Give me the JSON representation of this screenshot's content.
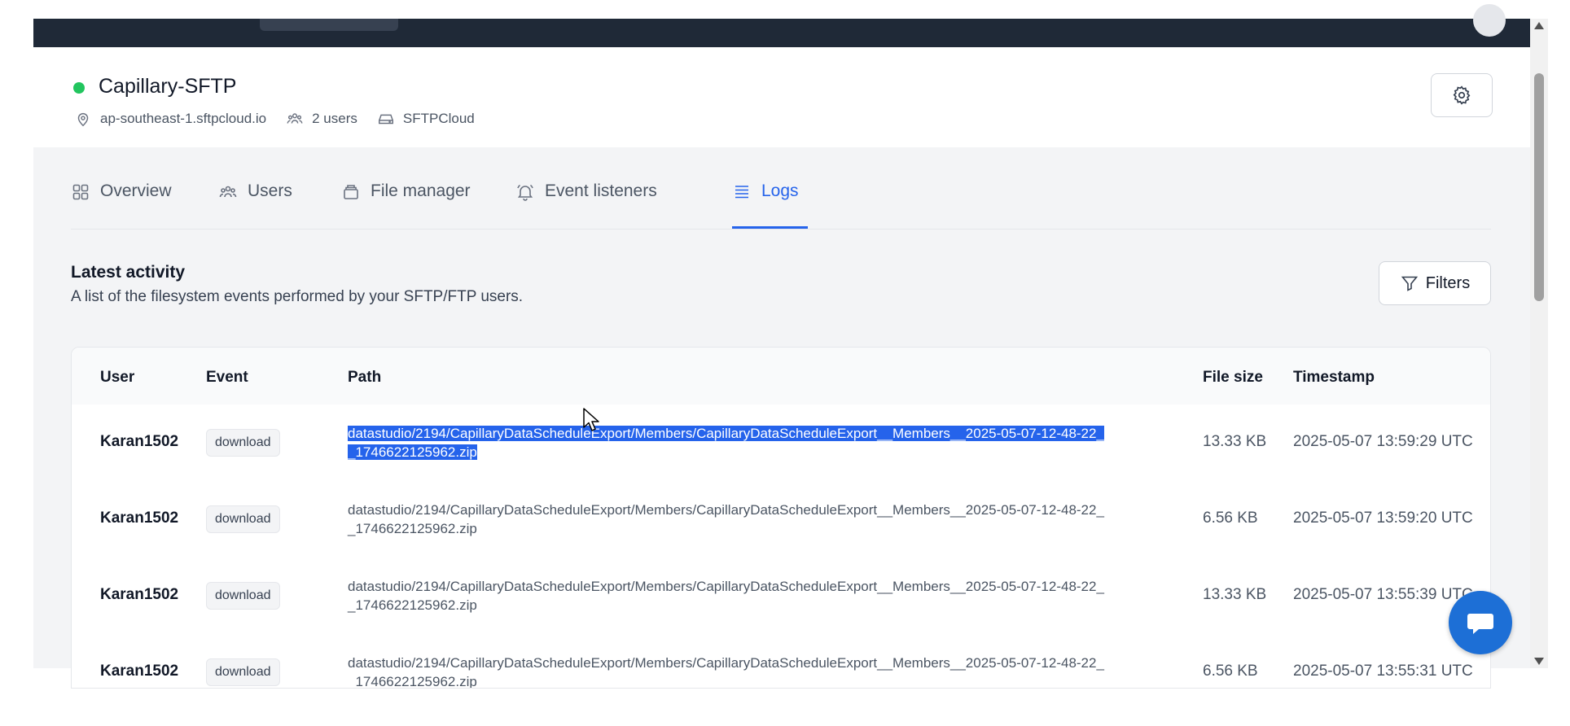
{
  "server": {
    "name": "Capillary-SFTP",
    "status_color": "#22c55e",
    "host": "ap-southeast-1.sftpcloud.io",
    "users": "2 users",
    "storage": "SFTPCloud"
  },
  "tabs": [
    {
      "label": "Overview",
      "icon": "grid-icon"
    },
    {
      "label": "Users",
      "icon": "users-icon"
    },
    {
      "label": "File manager",
      "icon": "archive-icon"
    },
    {
      "label": "Event listeners",
      "icon": "bell-icon"
    },
    {
      "label": "Logs",
      "icon": "list-icon",
      "active": true
    }
  ],
  "activity": {
    "title": "Latest activity",
    "description": "A list of the filesystem events performed by your SFTP/FTP users.",
    "filters_label": "Filters"
  },
  "table": {
    "headers": {
      "user": "User",
      "event": "Event",
      "path": "Path",
      "size": "File size",
      "timestamp": "Timestamp"
    },
    "rows": [
      {
        "user": "Karan1502",
        "event": "download",
        "path": "datastudio/2194/CapillaryDataScheduleExport/Members/CapillaryDataScheduleExport__Members__2025-05-07-12-48-22__1746622125962.zip",
        "size": "13.33 KB",
        "timestamp": "2025-05-07 13:59:29 UTC"
      },
      {
        "user": "Karan1502",
        "event": "download",
        "path": "datastudio/2194/CapillaryDataScheduleExport/Members/CapillaryDataScheduleExport__Members__2025-05-07-12-48-22__1746622125962.zip",
        "size": "6.56 KB",
        "timestamp": "2025-05-07 13:59:20 UTC"
      },
      {
        "user": "Karan1502",
        "event": "download",
        "path": "datastudio/2194/CapillaryDataScheduleExport/Members/CapillaryDataScheduleExport__Members__2025-05-07-12-48-22__1746622125962.zip",
        "size": "13.33 KB",
        "timestamp": "2025-05-07 13:55:39 UTC"
      },
      {
        "user": "Karan1502",
        "event": "download",
        "path": "datastudio/2194/CapillaryDataScheduleExport/Members/CapillaryDataScheduleExport__Members__2025-05-07-12-48-22__1746622125962.zip",
        "size": "6.56 KB",
        "timestamp": "2025-05-07 13:55:31 UTC"
      }
    ]
  },
  "colors": {
    "accent": "#2563eb",
    "topbar": "#1f2937",
    "chat": "#1d6fd6"
  }
}
